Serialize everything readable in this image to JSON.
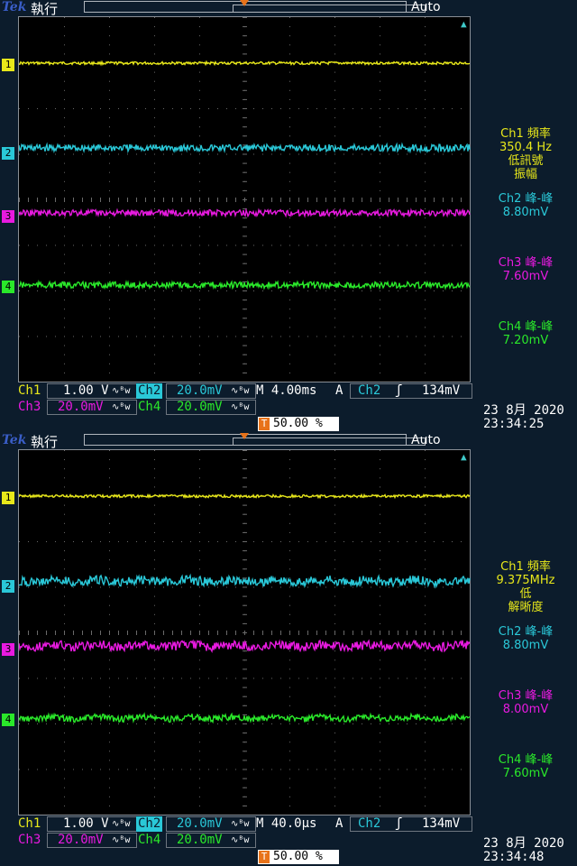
{
  "colors": {
    "ch1": "#e8e81a",
    "ch2": "#2ac8d8",
    "ch3": "#e81ae0",
    "ch4": "#2ae82a",
    "trigger": "#e8731a",
    "grid": "#6a6a6a"
  },
  "panels": [
    {
      "header": {
        "brand": "Tek",
        "state": "執行",
        "trigger_mode": "Auto"
      },
      "markers": [
        "1",
        "2",
        "3",
        "4"
      ],
      "measurements": {
        "ch1": {
          "lines": [
            "Ch1 頻率",
            "350.4 Hz",
            "低訊號",
            "振幅"
          ]
        },
        "ch2": {
          "lines": [
            "Ch2 峰-峰",
            "8.80mV"
          ]
        },
        "ch3": {
          "lines": [
            "Ch3 峰-峰",
            "7.60mV"
          ]
        },
        "ch4": {
          "lines": [
            "Ch4 峰-峰",
            "7.20mV"
          ]
        }
      },
      "status": {
        "ch1_label": "Ch1",
        "ch1_scale": "1.00 V",
        "coupling_icon": "∿ᴮw",
        "ch2_label": "Ch2",
        "ch2_scale": "20.0mV",
        "timebase": "M 4.00ms",
        "acq": "A",
        "trig_source": "Ch2",
        "trig_slope": "ʃ",
        "trig_level": "134mV",
        "ch3_label": "Ch3",
        "ch3_scale": "20.0mV",
        "ch4_label": "Ch4",
        "ch4_scale": "20.0mV",
        "trig_pos": "50.00 %",
        "date": "23 8月  2020",
        "time": "23:34:25"
      }
    },
    {
      "header": {
        "brand": "Tek",
        "state": "執行",
        "trigger_mode": "Auto"
      },
      "markers": [
        "1",
        "2",
        "3",
        "4"
      ],
      "measurements": {
        "ch1": {
          "lines": [
            "Ch1 頻率",
            "9.375MHz",
            "低",
            "解晰度"
          ]
        },
        "ch2": {
          "lines": [
            "Ch2 峰-峰",
            "8.80mV"
          ]
        },
        "ch3": {
          "lines": [
            "Ch3 峰-峰",
            "8.00mV"
          ]
        },
        "ch4": {
          "lines": [
            "Ch4 峰-峰",
            "7.60mV"
          ]
        }
      },
      "status": {
        "ch1_label": "Ch1",
        "ch1_scale": "1.00 V",
        "coupling_icon": "∿ᴮw",
        "ch2_label": "Ch2",
        "ch2_scale": "20.0mV",
        "timebase": "M 40.0µs",
        "acq": "A",
        "trig_source": "Ch2",
        "trig_slope": "ʃ",
        "trig_level": "134mV",
        "ch3_label": "Ch3",
        "ch3_scale": "20.0mV",
        "ch4_label": "Ch4",
        "ch4_scale": "20.0mV",
        "trig_pos": "50.00 %",
        "date": "23 8月  2020",
        "time": "23:34:48"
      }
    }
  ]
}
